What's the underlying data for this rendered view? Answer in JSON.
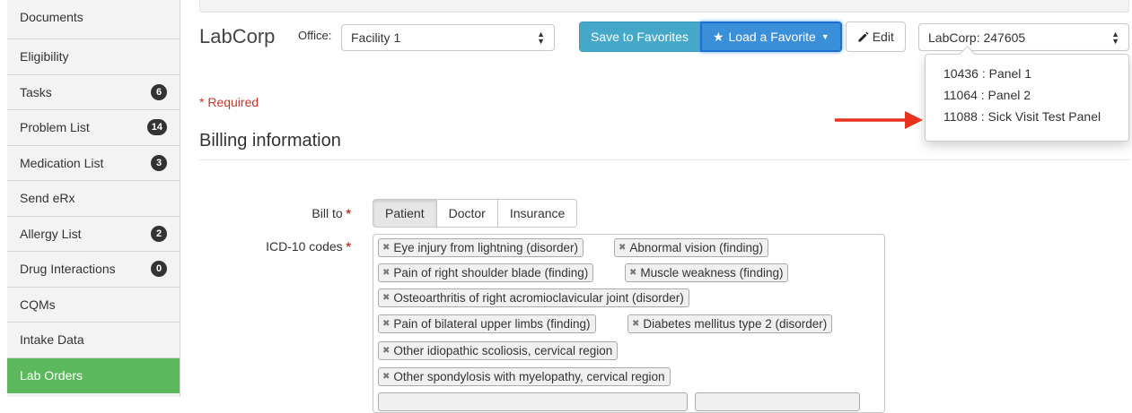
{
  "sidebar": {
    "items": [
      {
        "label": "Documents",
        "badge": null
      },
      {
        "label": "Eligibility",
        "badge": null
      },
      {
        "label": "Tasks",
        "badge": "6"
      },
      {
        "label": "Problem List",
        "badge": "14"
      },
      {
        "label": "Medication List",
        "badge": "3"
      },
      {
        "label": "Send eRx",
        "badge": null
      },
      {
        "label": "Allergy List",
        "badge": "2"
      },
      {
        "label": "Drug Interactions",
        "badge": "0"
      },
      {
        "label": "CQMs",
        "badge": null
      },
      {
        "label": "Intake Data",
        "badge": null
      },
      {
        "label": "Lab Orders",
        "badge": null
      }
    ],
    "active_color": "#5cb85c"
  },
  "header": {
    "brand": "LabCorp",
    "office_label": "Office:",
    "office_value": "Facility 1",
    "save_favorites": "Save to Favorites",
    "load_favorite": "Load a Favorite",
    "edit": "Edit",
    "lab_select": "LabCorp: 247605"
  },
  "dropdown": {
    "items": [
      "10436 : Panel 1",
      "11064 : Panel 2",
      "11088 : Sick Visit Test Panel"
    ]
  },
  "form": {
    "required_note": "* Required",
    "billing_title": "Billing information",
    "bill_to_label": "Bill to",
    "bill_to_options": [
      "Patient",
      "Doctor",
      "Insurance"
    ],
    "bill_to_selected": "Patient",
    "icd_label": "ICD-10 codes",
    "icd_codes": [
      "Eye injury from lightning (disorder)",
      "Abnormal vision (finding)",
      "Pain of right shoulder blade (finding)",
      "Muscle weakness (finding)",
      "Osteoarthritis of right acromioclavicular joint (disorder)",
      "Pain of bilateral upper limbs (finding)",
      "Diabetes mellitus type 2 (disorder)",
      "Other idiopathic scoliosis, cervical region",
      "Other spondylosis with myelopathy, cervical region"
    ]
  },
  "colors": {
    "info_button": "#46a8c8",
    "primary_button": "#3a8fd8",
    "required": "#c0392b",
    "annotation_arrow": "#e8321e"
  }
}
